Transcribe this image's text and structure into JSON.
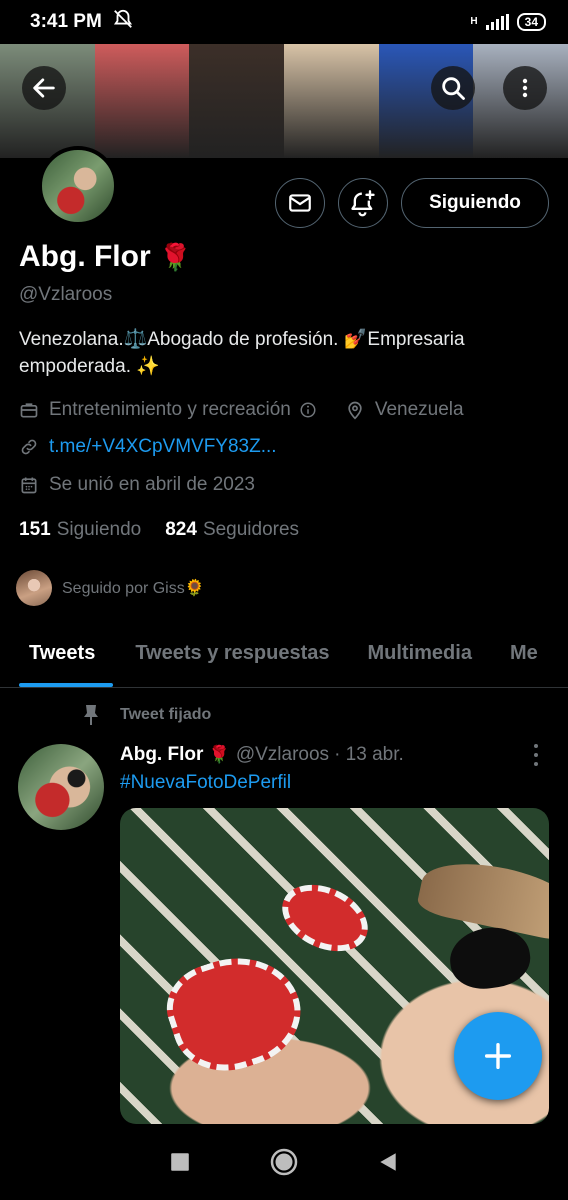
{
  "status_bar": {
    "time": "3:41 PM",
    "network": "H",
    "battery": "34"
  },
  "banner": {
    "colors": [
      "#7c8c7a",
      "#cf5c5c",
      "#3c2f28",
      "#d8c3a7",
      "#2a57b8",
      "#a8b1bf"
    ]
  },
  "profile": {
    "name": "Abg. Flor",
    "name_emoji": "🌹",
    "handle": "@Vzlaroos",
    "bio_line1": "Venezolana.⚖️Abogado de profesión. 💅Empresaria",
    "bio_line2": "empoderada. ✨",
    "category": "Entretenimiento y recreación",
    "location": "Venezuela",
    "link": "t.me/+V4XCpVMVFY83Z...",
    "joined": "Se unió en abril de 2023",
    "following_count": "151",
    "following_label": "Siguiendo",
    "followers_count": "824",
    "followers_label": "Seguidores",
    "followed_by": "Seguido por Giss🌻",
    "follow_button": "Siguiendo"
  },
  "tabs": [
    {
      "label": "Tweets",
      "active": true
    },
    {
      "label": "Tweets y respuestas",
      "active": false
    },
    {
      "label": "Multimedia",
      "active": false
    },
    {
      "label": "Me",
      "active": false
    }
  ],
  "tweet": {
    "pinned_label": "Tweet fijado",
    "author_name": "Abg. Flor",
    "author_emoji": "🌹",
    "author_handle": "@Vzlaroos",
    "date": "· 13 abr.",
    "text": "#NuevaFotoDePerfil"
  },
  "colors": {
    "accent": "#1d9bf0",
    "muted": "#71767b",
    "background": "#000000"
  },
  "icons": [
    "back-arrow-icon",
    "search-icon",
    "more-vertical-icon",
    "mail-icon",
    "bell-plus-icon",
    "briefcase-icon",
    "info-icon",
    "location-pin-icon",
    "link-icon",
    "calendar-icon",
    "pin-icon",
    "compose-plus-icon",
    "nav-recents-icon",
    "nav-home-icon",
    "nav-back-icon"
  ]
}
